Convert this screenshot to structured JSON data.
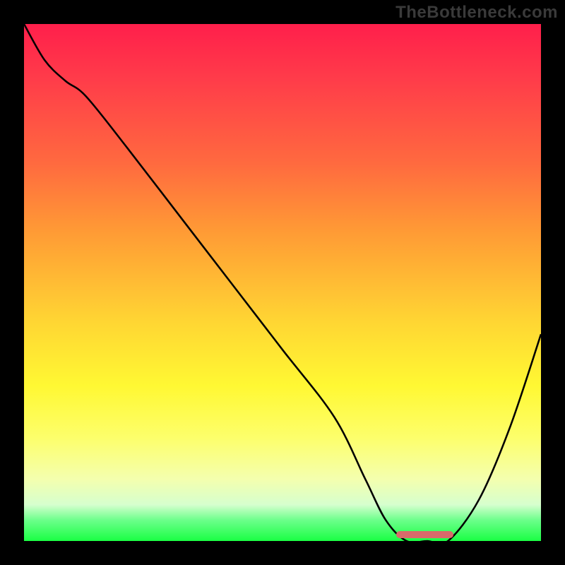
{
  "watermark": "TheBottleneck.com",
  "colors": {
    "frame": "#000000",
    "curve": "#000000",
    "highlight": "#d86b6b",
    "gradient_top": "#ff1f4b",
    "gradient_bottom": "#1aff44"
  },
  "chart_data": {
    "type": "line",
    "title": "",
    "xlabel": "",
    "ylabel": "",
    "xlim": [
      0,
      100
    ],
    "ylim": [
      0,
      100
    ],
    "x": [
      0,
      4,
      8,
      12,
      20,
      30,
      40,
      50,
      60,
      66,
      70,
      74,
      78,
      82,
      88,
      94,
      100
    ],
    "values": [
      100,
      93,
      89,
      86,
      76,
      63,
      50,
      37,
      24,
      12,
      4,
      0,
      0,
      0,
      8,
      22,
      40
    ],
    "optimal_range_x": [
      72,
      83
    ],
    "annotations": [],
    "grid": false,
    "legend": false
  }
}
